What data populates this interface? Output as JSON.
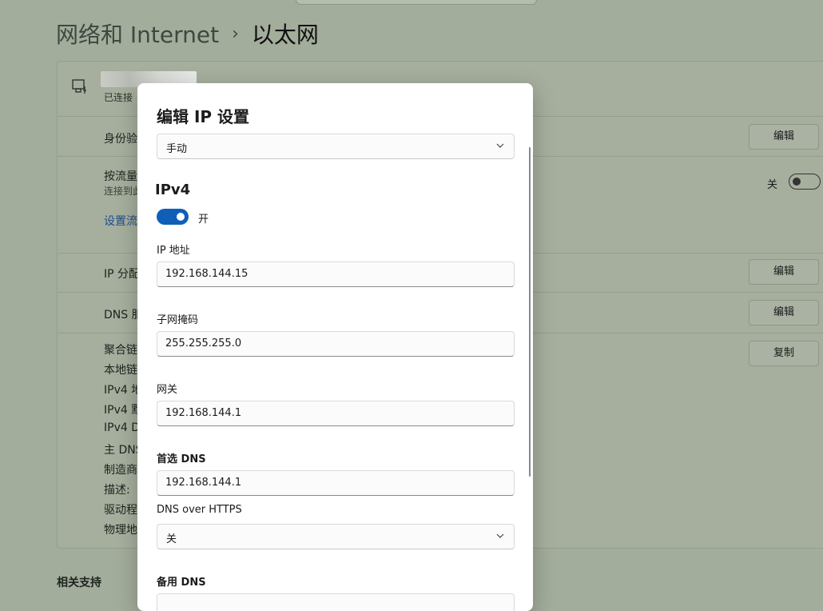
{
  "breadcrumb": {
    "parent": "网络和 Internet",
    "separator": "›",
    "current": "以太网"
  },
  "panel": {
    "status": "已连接",
    "rows": {
      "auth": {
        "label": "身份验",
        "button": "编辑"
      },
      "metered": {
        "label": "按流量",
        "sub": "连接到此",
        "toggle_label": "关",
        "link": "设置流"
      },
      "ip_assign": {
        "label": "IP 分配",
        "button": "编辑"
      },
      "dns": {
        "label": "DNS 服",
        "button": "编辑"
      }
    },
    "props": [
      "聚合链",
      "本地链",
      "IPv4 地",
      "IPv4 默",
      "IPv4 DI",
      "主 DNS",
      "制造商",
      "描述:",
      "驱动程",
      "物理地"
    ],
    "copy_button": "复制"
  },
  "related": "相关支持",
  "dialog": {
    "title": "编辑 IP 设置",
    "mode": "手动",
    "ipv4_heading": "IPv4",
    "ipv4_toggle_label": "开",
    "ip_label": "IP 地址",
    "ip_value": "192.168.144.15",
    "subnet_label": "子网掩码",
    "subnet_value": "255.255.255.0",
    "gateway_label": "网关",
    "gateway_value": "192.168.144.1",
    "preferred_dns_label": "首选 DNS",
    "preferred_dns_value": "192.168.144.1",
    "doh_label": "DNS over HTTPS",
    "doh_value": "关",
    "alternate_dns_label": "备用 DNS"
  },
  "colors": {
    "accent": "#0f5fb9",
    "link": "#204c8f"
  }
}
